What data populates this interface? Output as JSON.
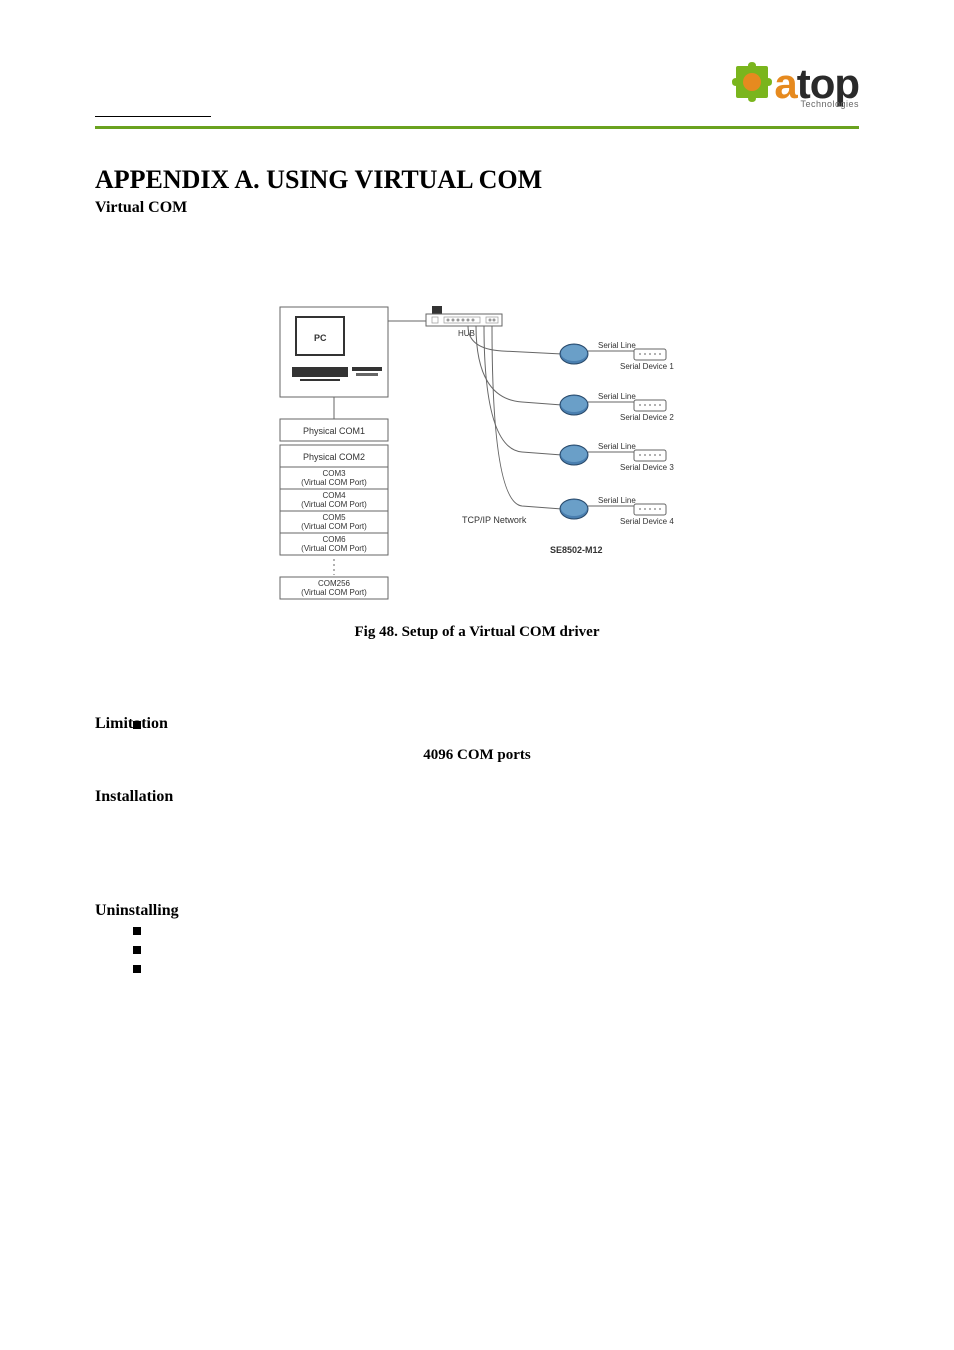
{
  "logo": {
    "brand_a": "a",
    "brand_top": "top",
    "subtitle": "Technologies"
  },
  "heading": {
    "appendix": "APPENDIX A. USING VIRTUAL COM",
    "subtitle": "Virtual COM"
  },
  "figure": {
    "pc": "PC",
    "hub": "HUB",
    "physical_com1": "Physical COM1",
    "physical_com2": "Physical COM2",
    "com3_a": "COM3",
    "com3_b": "(Virtual COM Port)",
    "com4_a": "COM4",
    "com4_b": "(Virtual COM Port)",
    "com5_a": "COM5",
    "com5_b": "(Virtual COM Port)",
    "com6_a": "COM6",
    "com6_b": "(Virtual COM Port)",
    "com256_a": "COM256",
    "com256_b": "(Virtual COM Port)",
    "tcpip": "TCP/IP Network",
    "device_model": "SE8502-M12",
    "serial_line": "Serial Line",
    "serial_device1": "Serial Device 1",
    "serial_device2": "Serial Device 2",
    "serial_device3": "Serial Device 3",
    "serial_device4": "Serial Device 4",
    "caption": "Fig 48. Setup of a Virtual COM driver"
  },
  "bullets": {
    "b1": "",
    "b2": "",
    "b3": "",
    "b4": ""
  },
  "sections": {
    "limitation_title": "Limitation",
    "limitation_ports": "4096 COM ports",
    "installation_title": "Installation",
    "uninstalling_title": "Uninstalling"
  },
  "uninstall_bullets": {
    "u1": "",
    "u2": "",
    "u3": ""
  }
}
